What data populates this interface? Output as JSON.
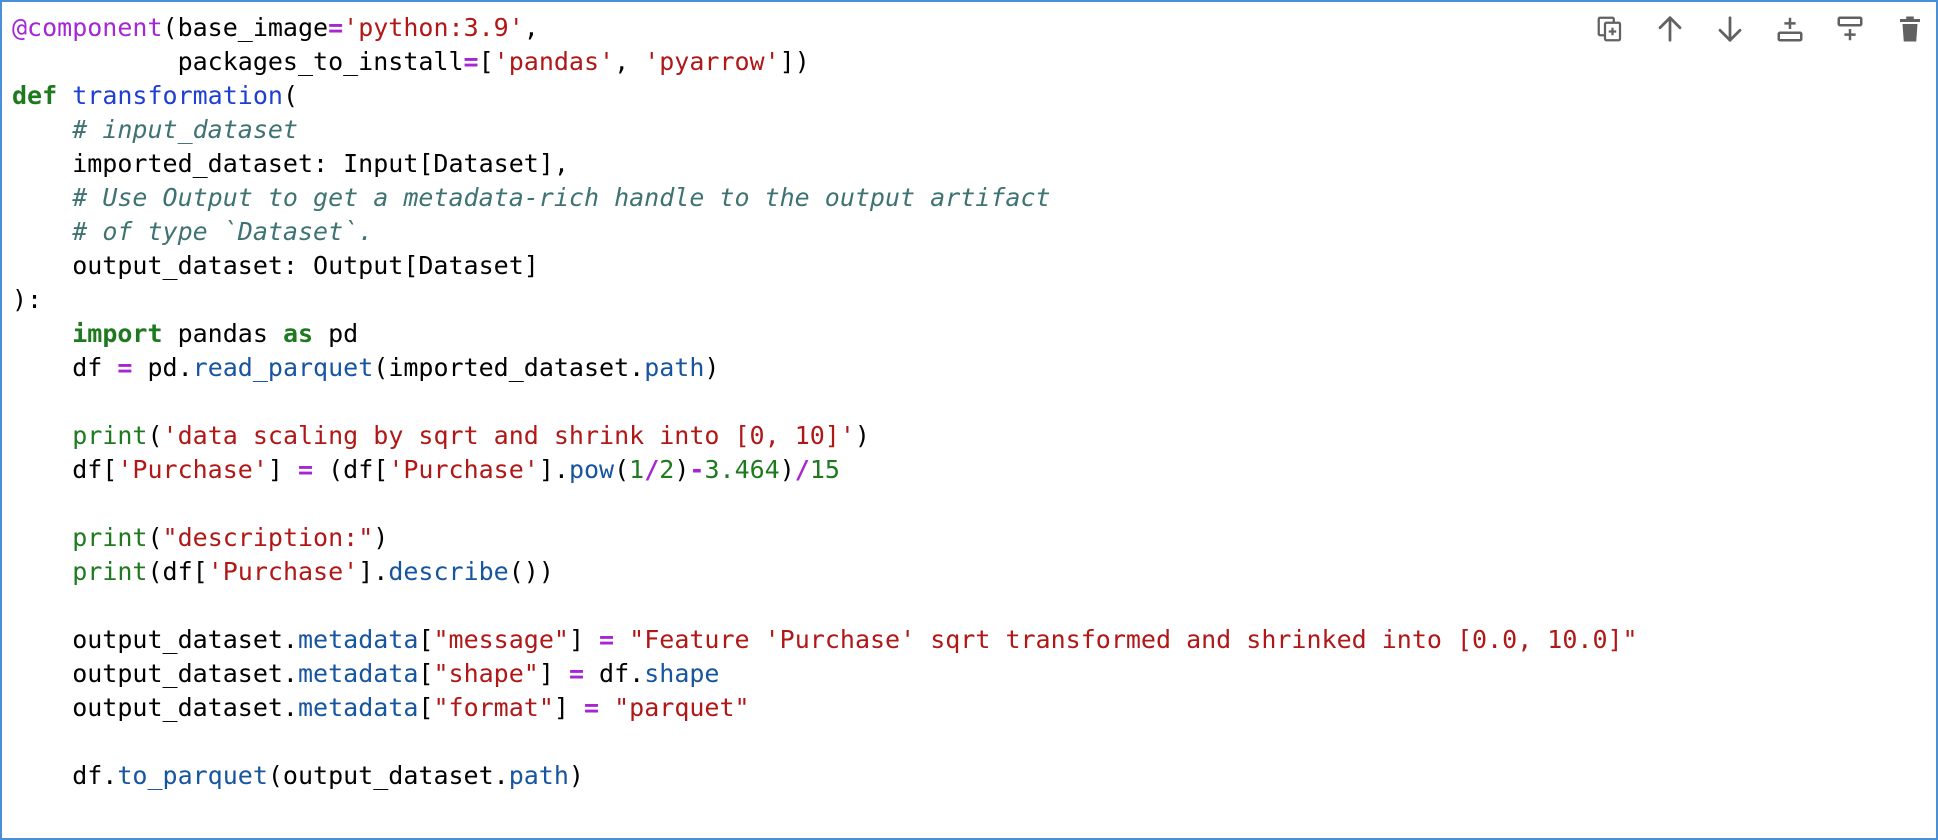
{
  "toolbar": [
    {
      "icon": "duplicate-cell-icon"
    },
    {
      "icon": "move-up-arrow-icon"
    },
    {
      "icon": "move-down-arrow-icon"
    },
    {
      "icon": "insert-cell-above-icon"
    },
    {
      "icon": "insert-cell-below-icon"
    },
    {
      "icon": "delete-trash-icon"
    }
  ],
  "colors": {
    "cell_border": "#4a90d9",
    "keyword": "#1f7a1f",
    "decorator": "#a626d5",
    "function_name": "#1f3fd0",
    "string": "#b01818",
    "comment": "#3f7373",
    "operator": "#a626d5",
    "number": "#1f7a1f",
    "attribute": "#1755a0"
  },
  "code_lines": [
    [
      [
        "decorator",
        "@component"
      ],
      [
        "default",
        "(base_image"
      ],
      [
        "operator",
        "="
      ],
      [
        "string",
        "'python:3.9'"
      ],
      [
        "default",
        ","
      ]
    ],
    [
      [
        "default",
        "           packages_to_install"
      ],
      [
        "operator",
        "="
      ],
      [
        "default",
        "["
      ],
      [
        "string",
        "'pandas'"
      ],
      [
        "default",
        ", "
      ],
      [
        "string",
        "'pyarrow'"
      ],
      [
        "default",
        "])"
      ]
    ],
    [
      [
        "keyword",
        "def"
      ],
      [
        "default",
        " "
      ],
      [
        "def",
        "transformation"
      ],
      [
        "default",
        "("
      ]
    ],
    [
      [
        "default",
        "    "
      ],
      [
        "comment",
        "# input_dataset"
      ]
    ],
    [
      [
        "default",
        "    imported_dataset: Input[Dataset],"
      ]
    ],
    [
      [
        "default",
        "    "
      ],
      [
        "comment",
        "# Use Output to get a metadata-rich handle to the output artifact"
      ]
    ],
    [
      [
        "default",
        "    "
      ],
      [
        "comment",
        "# of type `Dataset`."
      ]
    ],
    [
      [
        "default",
        "    output_dataset: Output[Dataset]"
      ]
    ],
    [
      [
        "default",
        "):"
      ]
    ],
    [
      [
        "default",
        "    "
      ],
      [
        "keyword",
        "import"
      ],
      [
        "default",
        " pandas "
      ],
      [
        "keyword",
        "as"
      ],
      [
        "default",
        " pd"
      ]
    ],
    [
      [
        "default",
        "    df "
      ],
      [
        "operator",
        "="
      ],
      [
        "default",
        " pd."
      ],
      [
        "attr",
        "read_parquet"
      ],
      [
        "default",
        "(imported_dataset."
      ],
      [
        "attr",
        "path"
      ],
      [
        "default",
        ")"
      ]
    ],
    [],
    [
      [
        "default",
        "    "
      ],
      [
        "builtin",
        "print"
      ],
      [
        "default",
        "("
      ],
      [
        "string",
        "'data scaling by sqrt and shrink into [0, 10]'"
      ],
      [
        "default",
        ")"
      ]
    ],
    [
      [
        "default",
        "    df["
      ],
      [
        "string",
        "'Purchase'"
      ],
      [
        "default",
        "] "
      ],
      [
        "operator",
        "="
      ],
      [
        "default",
        " (df["
      ],
      [
        "string",
        "'Purchase'"
      ],
      [
        "default",
        "]."
      ],
      [
        "attr",
        "pow"
      ],
      [
        "default",
        "("
      ],
      [
        "number",
        "1"
      ],
      [
        "operator",
        "/"
      ],
      [
        "number",
        "2"
      ],
      [
        "default",
        ")"
      ],
      [
        "operator",
        "-"
      ],
      [
        "number",
        "3.464"
      ],
      [
        "default",
        ")"
      ],
      [
        "operator",
        "/"
      ],
      [
        "number",
        "15"
      ]
    ],
    [],
    [
      [
        "default",
        "    "
      ],
      [
        "builtin",
        "print"
      ],
      [
        "default",
        "("
      ],
      [
        "string",
        "\"description:\""
      ],
      [
        "default",
        ")"
      ]
    ],
    [
      [
        "default",
        "    "
      ],
      [
        "builtin",
        "print"
      ],
      [
        "default",
        "(df["
      ],
      [
        "string",
        "'Purchase'"
      ],
      [
        "default",
        "]."
      ],
      [
        "attr",
        "describe"
      ],
      [
        "default",
        "())"
      ]
    ],
    [],
    [
      [
        "default",
        "    output_dataset."
      ],
      [
        "attr",
        "metadata"
      ],
      [
        "default",
        "["
      ],
      [
        "string",
        "\"message\""
      ],
      [
        "default",
        "] "
      ],
      [
        "operator",
        "="
      ],
      [
        "default",
        " "
      ],
      [
        "string",
        "\"Feature 'Purchase' sqrt transformed and shrinked into [0.0, 10.0]\""
      ]
    ],
    [
      [
        "default",
        "    output_dataset."
      ],
      [
        "attr",
        "metadata"
      ],
      [
        "default",
        "["
      ],
      [
        "string",
        "\"shape\""
      ],
      [
        "default",
        "] "
      ],
      [
        "operator",
        "="
      ],
      [
        "default",
        " df."
      ],
      [
        "attr",
        "shape"
      ]
    ],
    [
      [
        "default",
        "    output_dataset."
      ],
      [
        "attr",
        "metadata"
      ],
      [
        "default",
        "["
      ],
      [
        "string",
        "\"format\""
      ],
      [
        "default",
        "] "
      ],
      [
        "operator",
        "="
      ],
      [
        "default",
        " "
      ],
      [
        "string",
        "\"parquet\""
      ]
    ],
    [],
    [
      [
        "default",
        "    df."
      ],
      [
        "attr",
        "to_parquet"
      ],
      [
        "default",
        "(output_dataset."
      ],
      [
        "attr",
        "path"
      ],
      [
        "default",
        ")"
      ]
    ]
  ]
}
